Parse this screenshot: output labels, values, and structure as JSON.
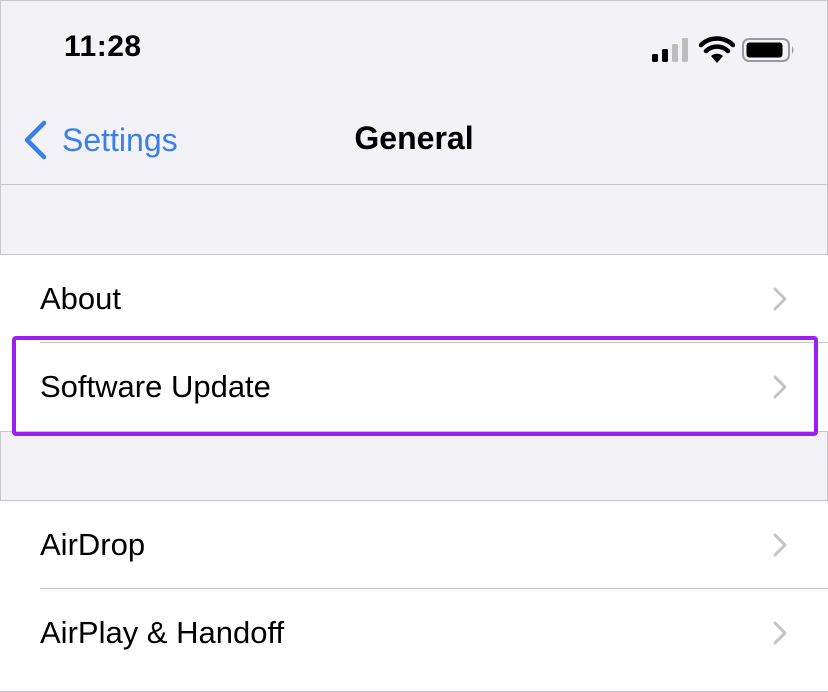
{
  "status_bar": {
    "time": "11:28",
    "icons": [
      "signal-icon",
      "wifi-icon",
      "battery-icon"
    ]
  },
  "nav": {
    "back_label": "Settings",
    "title": "General",
    "accent_color": "#3a80e8"
  },
  "groups": [
    {
      "items": [
        {
          "label": "About"
        },
        {
          "label": "Software Update",
          "highlighted": true
        }
      ]
    },
    {
      "items": [
        {
          "label": "AirDrop"
        },
        {
          "label": "AirPlay & Handoff"
        }
      ]
    }
  ],
  "highlight_color": "#9a1ff0"
}
